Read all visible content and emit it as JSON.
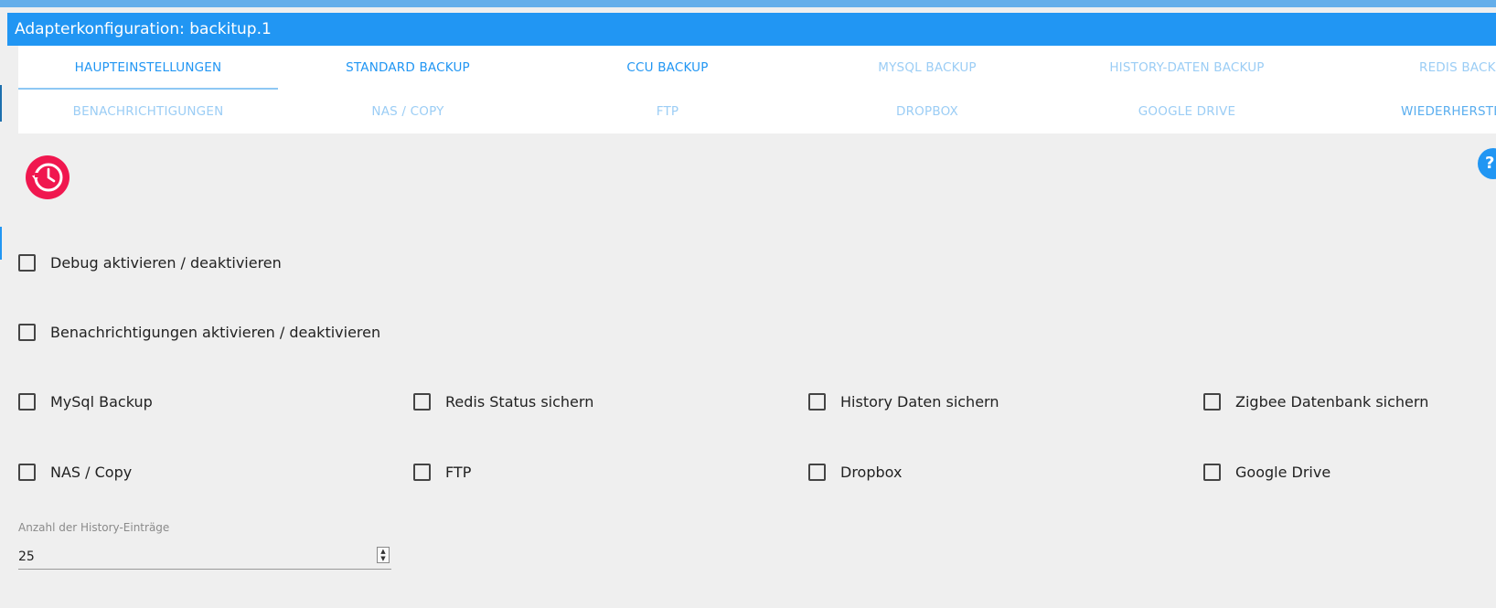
{
  "window": {
    "title": "Adapterkonfiguration: backitup.1"
  },
  "tabs": [
    {
      "label": "HAUPTEINSTELLUNGEN",
      "active": true
    },
    {
      "label": "STANDARD BACKUP",
      "active": false
    },
    {
      "label": "CCU BACKUP",
      "active": false
    },
    {
      "label": "MYSQL BACKUP",
      "active": false
    },
    {
      "label": "HISTORY-DATEN BACKUP",
      "active": false
    },
    {
      "label": "REDIS BACKUP",
      "active": false
    },
    {
      "label": "BENACHRICHTIGUNGEN",
      "active": false
    },
    {
      "label": "NAS / COPY",
      "active": false
    },
    {
      "label": "FTP",
      "active": false
    },
    {
      "label": "DROPBOX",
      "active": false
    },
    {
      "label": "GOOGLE DRIVE",
      "active": false
    },
    {
      "label": "WIEDERHERSTELLEN",
      "active": false
    }
  ],
  "logo": {
    "icon": "backup-history-icon",
    "color": "#f0174f"
  },
  "help": {
    "icon": "help-icon",
    "label": "?"
  },
  "options": {
    "debug": {
      "label": "Debug aktivieren / deaktivieren",
      "checked": false
    },
    "notifications": {
      "label": "Benachrichtigungen aktivieren / deaktivieren",
      "checked": false
    },
    "mysql": {
      "label": "MySql Backup",
      "checked": false
    },
    "redis": {
      "label": "Redis Status sichern",
      "checked": false
    },
    "history": {
      "label": "History Daten sichern",
      "checked": false
    },
    "zigbee": {
      "label": "Zigbee Datenbank sichern",
      "checked": false
    },
    "nas": {
      "label": "NAS / Copy",
      "checked": false
    },
    "ftp": {
      "label": "FTP",
      "checked": false
    },
    "dropbox": {
      "label": "Dropbox",
      "checked": false
    },
    "gdrive": {
      "label": "Google Drive",
      "checked": false
    }
  },
  "history_entries": {
    "label": "Anzahl der History-Einträge",
    "value": "25"
  },
  "colors": {
    "accent": "#2196f3",
    "tab_inactive": "#9bcdf5",
    "logo": "#f0174f"
  }
}
